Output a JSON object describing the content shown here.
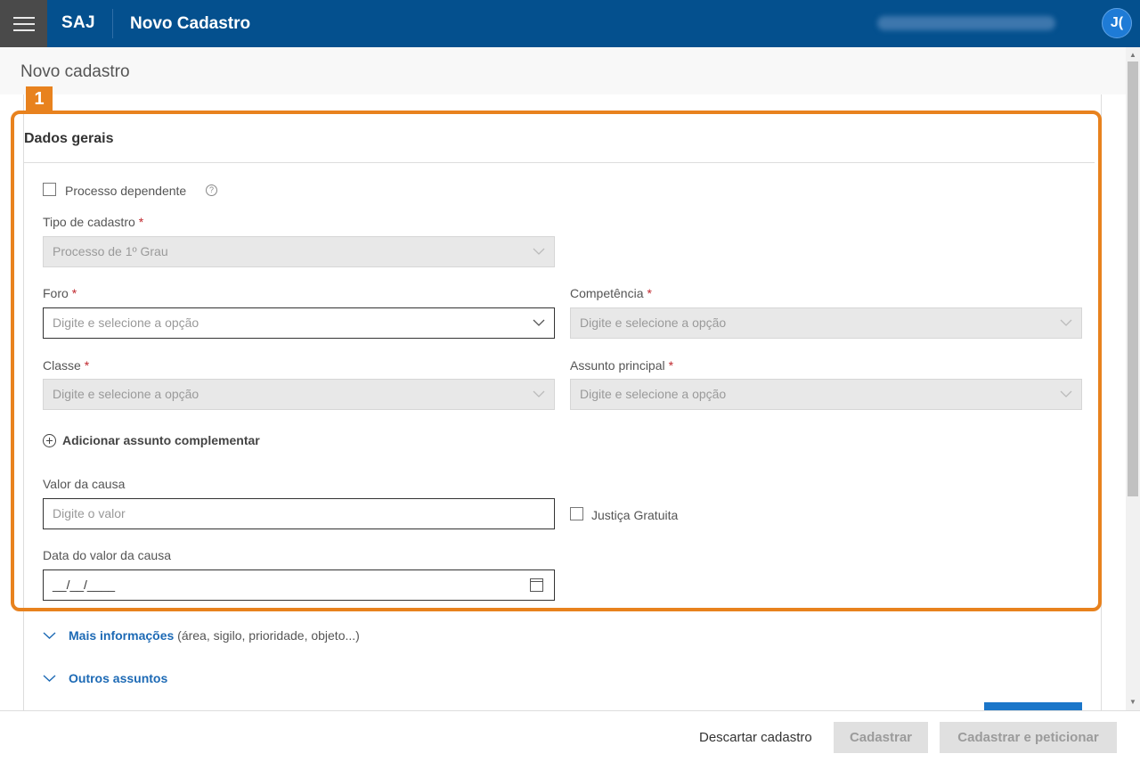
{
  "header": {
    "brand": "SAJ",
    "app_title": "Novo Cadastro",
    "avatar_initials": "J("
  },
  "page": {
    "title": "Novo cadastro"
  },
  "annotation": {
    "badge": "1"
  },
  "section": {
    "title": "Dados gerais",
    "processo_dependente_label": "Processo dependente",
    "tipo_cadastro_label": "Tipo de cadastro",
    "tipo_cadastro_value": "Processo de 1º Grau",
    "foro_label": "Foro",
    "foro_placeholder": "Digite e selecione a opção",
    "competencia_label": "Competência",
    "competencia_placeholder": "Digite e selecione a opção",
    "classe_label": "Classe",
    "classe_placeholder": "Digite e selecione a opção",
    "assunto_label": "Assunto principal",
    "assunto_placeholder": "Digite e selecione a opção",
    "add_assunto_label": "Adicionar assunto complementar",
    "valor_causa_label": "Valor da causa",
    "valor_causa_placeholder": "Digite o valor",
    "justica_gratuita_label": "Justiça Gratuita",
    "data_valor_label": "Data do valor da causa",
    "data_valor_value": "__/__/____",
    "required_mark": "*"
  },
  "collapsibles": {
    "mais_info_label": "Mais informações",
    "mais_info_extra": "(área, sigilo, prioridade, objeto...)",
    "outros_assuntos_label": "Outros assuntos"
  },
  "footer": {
    "discard_label": "Descartar cadastro",
    "register_label": "Cadastrar",
    "register_petition_label": "Cadastrar e peticionar"
  }
}
